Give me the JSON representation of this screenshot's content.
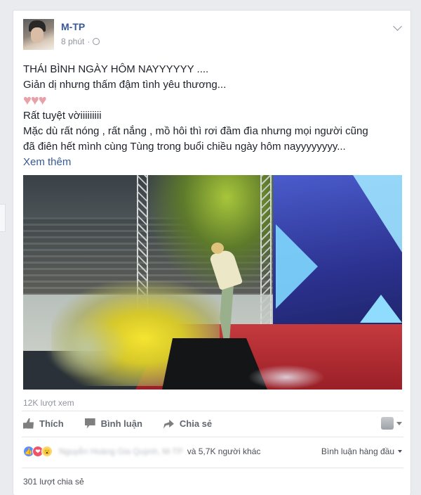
{
  "post": {
    "author": "M-TP",
    "time": "8 phút",
    "lines": [
      "THÁI BÌNH NGÀY HÔM NAYYYYYY ....",
      "Giản dị nhưng thấm đậm tình yêu thương...",
      "Rất tuyệt vờiiiiiiiii",
      "Mặc dù rất nóng , rất nắng , mồ hôi thì rơi đầm đìa nhưng mọi người cũng",
      "đã điên hết mình cùng Tùng trong buổi chiều ngày hôm nayyyyyyyy..."
    ],
    "hearts": "♥♥♥",
    "see_more": "Xem thêm"
  },
  "stats": {
    "views": "12K lượt xem",
    "reaction_names": "Nguyễn Hoàng Gia Quỳnh, M-TP",
    "others": "và 5,7K người khác",
    "shares": "301 lượt chia sẻ"
  },
  "actions": {
    "like": "Thích",
    "comment": "Bình luận",
    "share": "Chia sẻ"
  },
  "top_comments": "Bình luận hàng đầu",
  "reaction_icons": {
    "like": "👍",
    "love": "❤",
    "wow": "😮"
  },
  "colors": {
    "link": "#365899",
    "secondary_text": "#90949c",
    "heart": "#e8a2a7"
  }
}
